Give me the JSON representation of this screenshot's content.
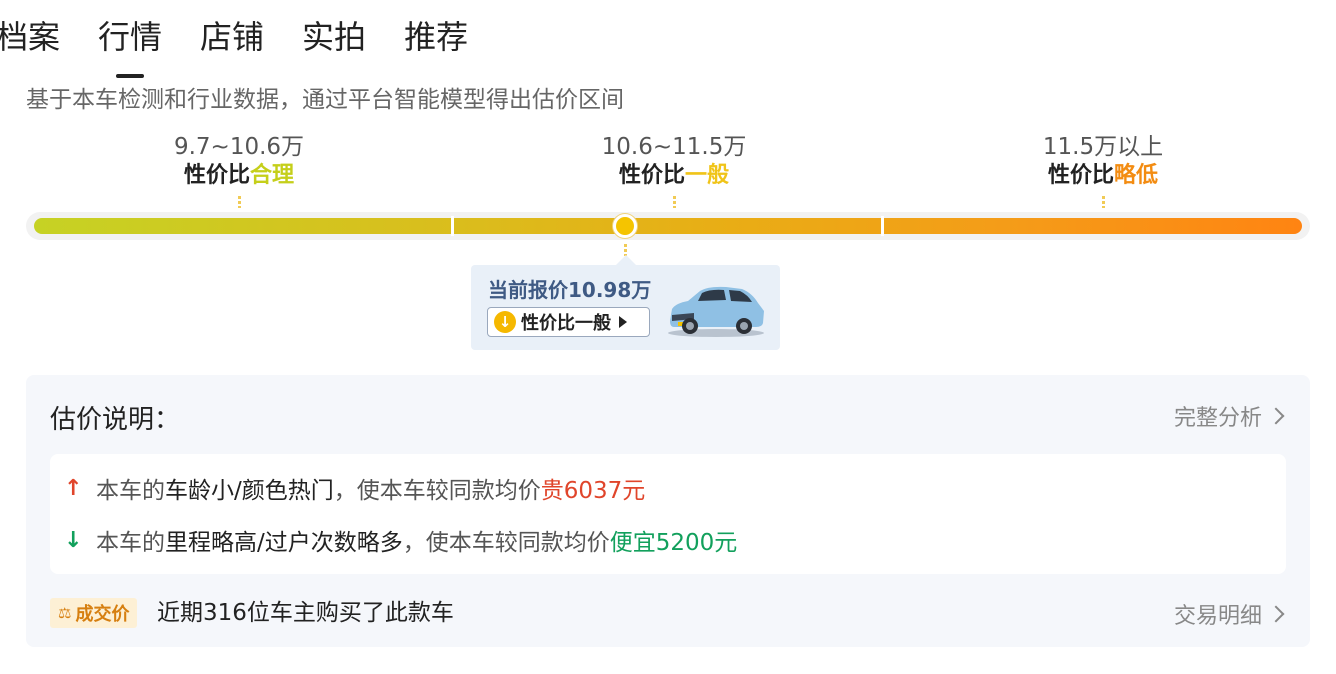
{
  "tabs": [
    "档案",
    "行情",
    "店铺",
    "实拍",
    "推荐"
  ],
  "active_tab": "行情",
  "subtitle": "基于本车检测和行业数据，通过平台智能模型得出估价区间",
  "ranges": [
    {
      "price": "9.7~10.6万",
      "rating_prefix": "性价比",
      "rating": "合理",
      "color": "#c5cf1a"
    },
    {
      "price": "10.6~11.5万",
      "rating_prefix": "性价比",
      "rating": "一般",
      "color": "#f0c419"
    },
    {
      "price": "11.5万以上",
      "rating_prefix": "性价比",
      "rating": "略低",
      "color": "#f38c12"
    }
  ],
  "current": {
    "label": "当前报价10.98万",
    "chip_text": "性价比一般",
    "chip_icon": "arrow-down-circle-icon",
    "position_fraction": 0.47
  },
  "panel": {
    "title": "估价说明：",
    "full_analysis": "完整分析",
    "reasons": [
      {
        "direction": "up",
        "icon": "arrow-up-icon",
        "prefix": "本车的",
        "factors": "车龄小/颜色热门",
        "middle": "，使本车较同款均价",
        "delta": "贵6037元",
        "color": "#e0452b"
      },
      {
        "direction": "down",
        "icon": "arrow-down-icon",
        "prefix": "本车的",
        "factors": "里程略高/过户次数略多",
        "middle": "，使本车较同款均价",
        "delta": "便宜5200元",
        "color": "#12a05c"
      }
    ],
    "tag_label": "成交价",
    "summary": "近期316位车主购买了此款车",
    "trade_detail": "交易明细"
  }
}
